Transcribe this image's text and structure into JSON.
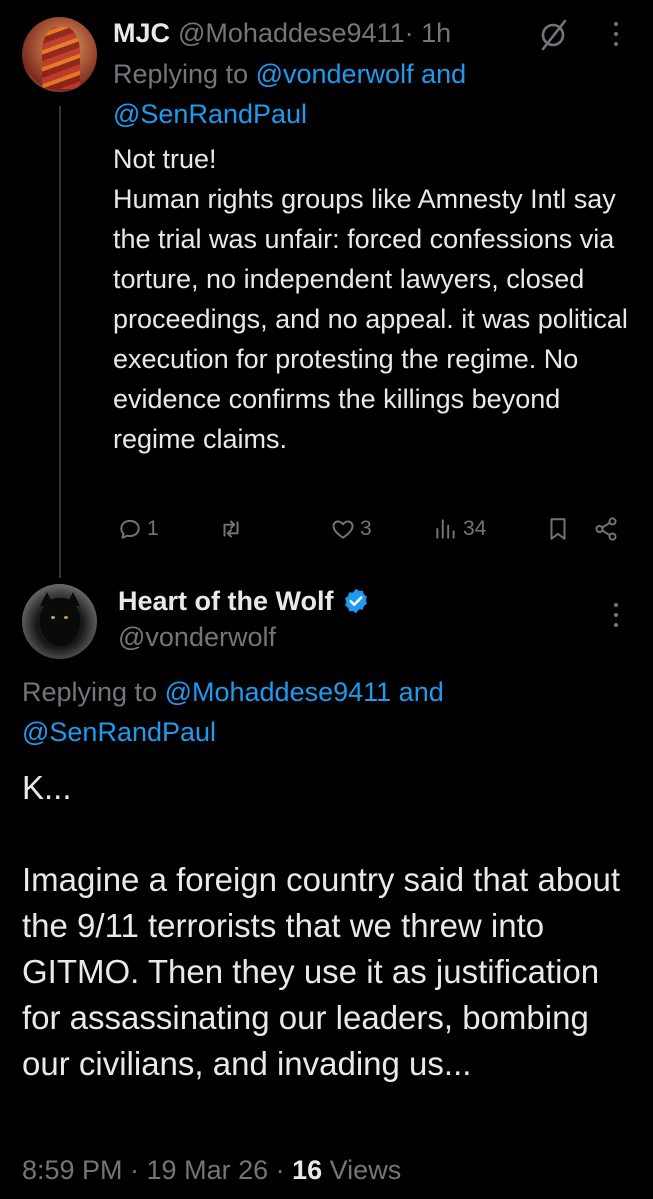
{
  "colors": {
    "background": "#000000",
    "text_primary": "#e7e9ea",
    "text_muted": "#71767b",
    "link": "#1d9bf0",
    "verified": "#1d9bf0",
    "thread_line": "#333639"
  },
  "reply": {
    "display_name": "MJC",
    "handle": "@Mohaddese9411",
    "time": " · 1h",
    "replying_prefix": "Replying to ",
    "replying_user1": "@vonderwolf",
    "replying_and": " and",
    "replying_user2": "@SenRandPaul",
    "body_lines": [
      "Not true!",
      "Human rights groups like Amnesty Intl say the trial was unfair: forced confessions via torture, no independent lawyers, closed proceedings, and no appeal. it was political execution for protesting the regime. No evidence confirms the killings beyond regime claims."
    ],
    "actions": {
      "replies": "1",
      "reposts": "",
      "likes": "3",
      "views": "34"
    },
    "icons": [
      "translate-icon",
      "more-icon",
      "reply-icon",
      "repost-icon",
      "like-icon",
      "views-icon",
      "bookmark-icon",
      "share-icon"
    ]
  },
  "main": {
    "display_name": "Heart of the Wolf",
    "handle": "@vonderwolf",
    "replying_prefix": "Replying to ",
    "replying_user1": "@Mohaddese9411",
    "replying_and": " and",
    "replying_user2": "@SenRandPaul",
    "body_line1": "K...",
    "body_line2": "Imagine a foreign country said that about the 9/11 terrorists that we threw into GITMO. Then they use it as justification for assassinating our leaders, bombing our civilians, and invading us...",
    "timestamp": "8:59 PM · 19 Mar 26 · ",
    "views_count": "16",
    "views_label": " Views",
    "icons": [
      "verified-icon",
      "more-icon"
    ]
  }
}
